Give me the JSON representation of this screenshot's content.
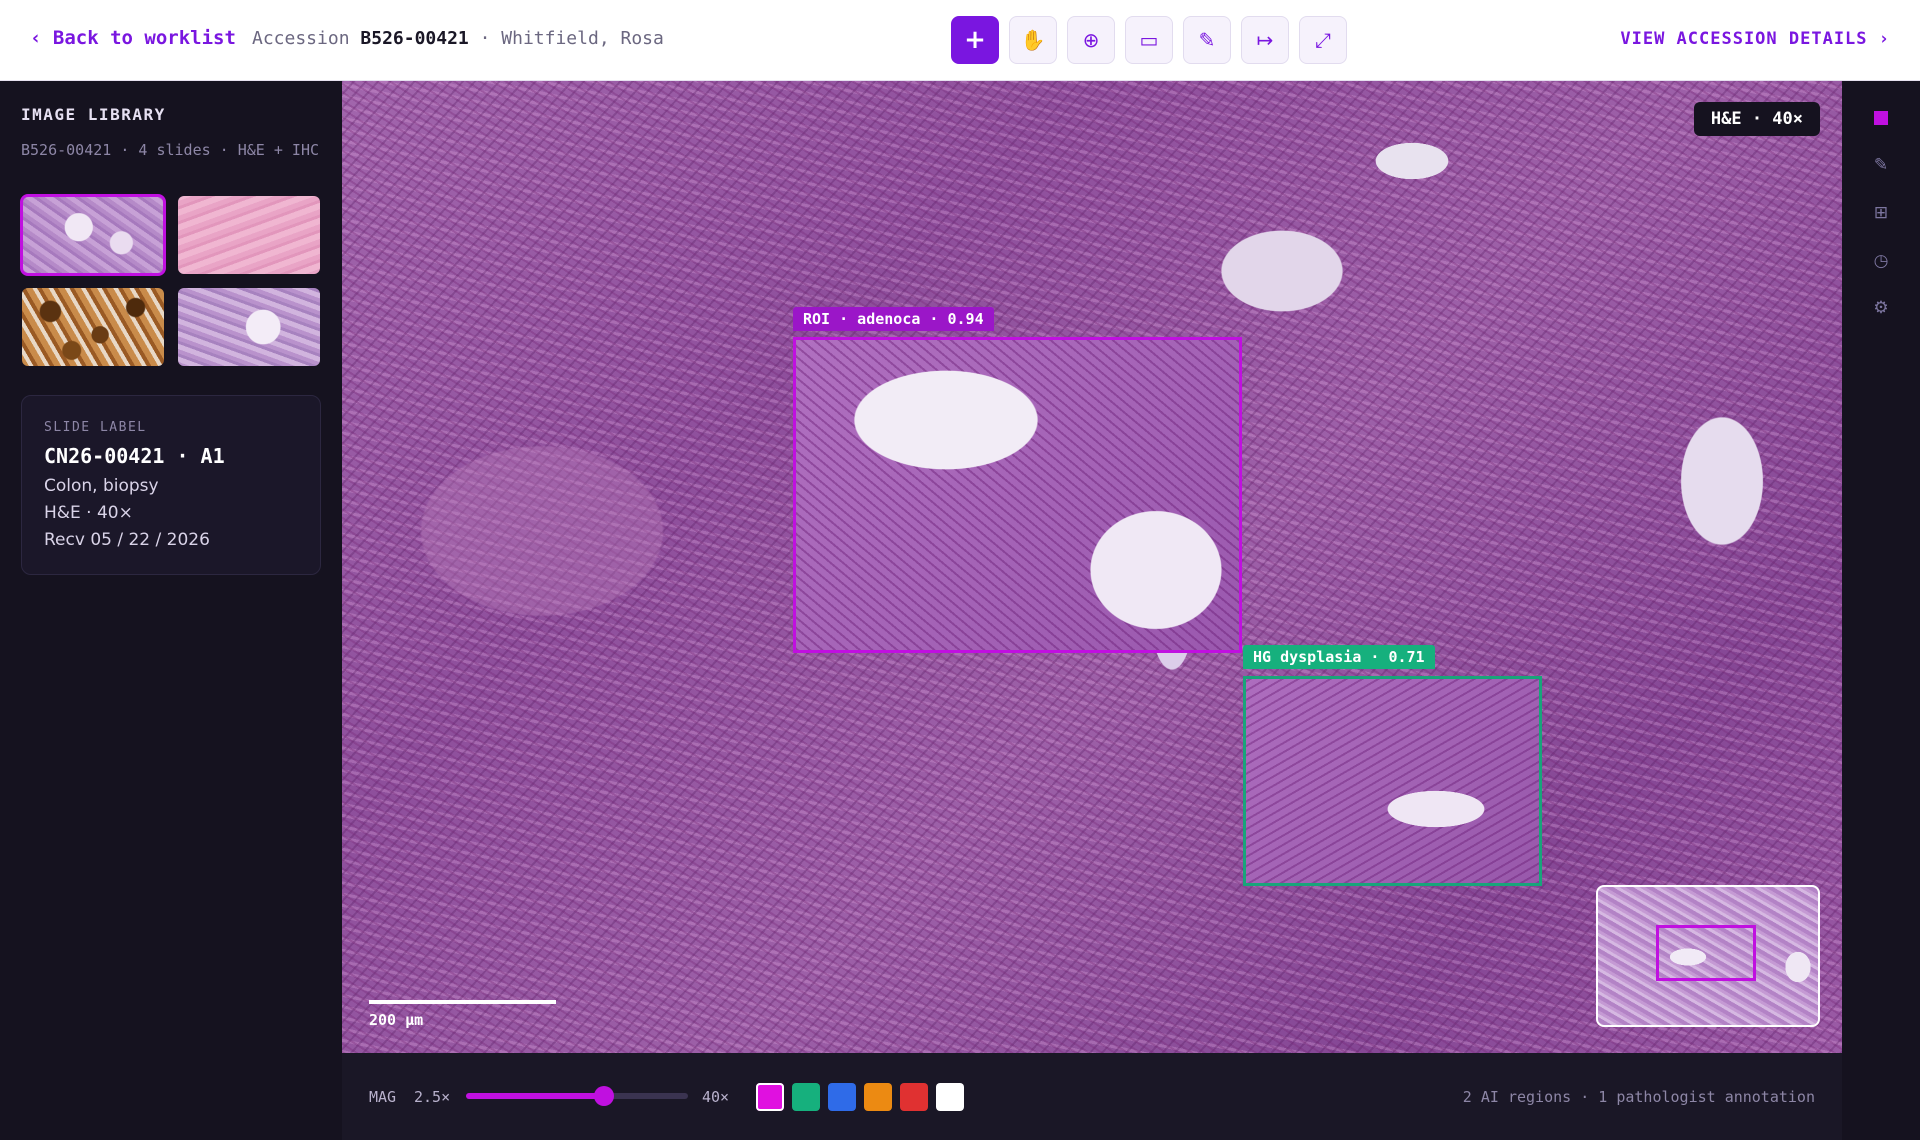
{
  "topbar": {
    "back_label": "‹ Back to worklist",
    "accession_prefix": "Accession",
    "accession_id": "B526-00421",
    "patient": "· Whitfield, Rosa",
    "details_label": "VIEW ACCESSION DETAILS ›",
    "tools": [
      {
        "name": "crosshair-tool",
        "icon": "plus-icon",
        "glyph": "+",
        "active": true
      },
      {
        "name": "pan-tool",
        "icon": "hand-icon",
        "glyph": "✋",
        "active": false
      },
      {
        "name": "target-tool",
        "icon": "target-icon",
        "glyph": "⊕",
        "active": false
      },
      {
        "name": "rectangle-tool",
        "icon": "rectangle-icon",
        "glyph": "▭",
        "active": false
      },
      {
        "name": "pen-tool",
        "icon": "pencil-icon",
        "glyph": "✎",
        "active": false
      },
      {
        "name": "measure-tool",
        "icon": "arrow-right-icon",
        "glyph": "↦",
        "active": false
      },
      {
        "name": "expand-tool",
        "icon": "expand-icon",
        "glyph": "⤢",
        "active": false
      }
    ]
  },
  "library": {
    "title": "IMAGE LIBRARY",
    "subtitle": "B526-00421 · 4 slides · H&E + IHC",
    "thumbnails": [
      {
        "stain": "H&E",
        "selected": true
      },
      {
        "stain": "H&E",
        "selected": false
      },
      {
        "stain": "IHC",
        "selected": false
      },
      {
        "stain": "H&E",
        "selected": false
      }
    ]
  },
  "slide_label": {
    "caption": "SLIDE LABEL",
    "id": "CN26-00421 · A1",
    "site": "Colon, biopsy",
    "stain": "H&E · 40×",
    "received": "Recv 05 / 22 / 2026"
  },
  "viewer": {
    "stain_pill": "H&E · 40×",
    "regions": [
      {
        "label": "ROI · adenoca · 0.94",
        "color": "#c010e0"
      },
      {
        "label": "HG dysplasia · 0.71",
        "color": "#18a57a"
      }
    ],
    "scale_label": "200 µm"
  },
  "bottombar": {
    "mag_label": "MAG",
    "mag_min": "2.5×",
    "mag_max": "40×",
    "mag_level_fraction": 0.62,
    "swatches": [
      "#e010e0",
      "#16b07d",
      "#2f6be8",
      "#ec8a12",
      "#e03131",
      "#ffffff"
    ],
    "status": "2 AI regions · 1 pathologist annotation"
  },
  "rail": [
    {
      "name": "annotation-color-icon"
    },
    {
      "name": "pencil-icon",
      "glyph": "✎"
    },
    {
      "name": "grid-icon",
      "glyph": "⊞"
    },
    {
      "name": "history-icon",
      "glyph": "◷"
    },
    {
      "name": "gear-icon",
      "glyph": "⚙"
    }
  ]
}
